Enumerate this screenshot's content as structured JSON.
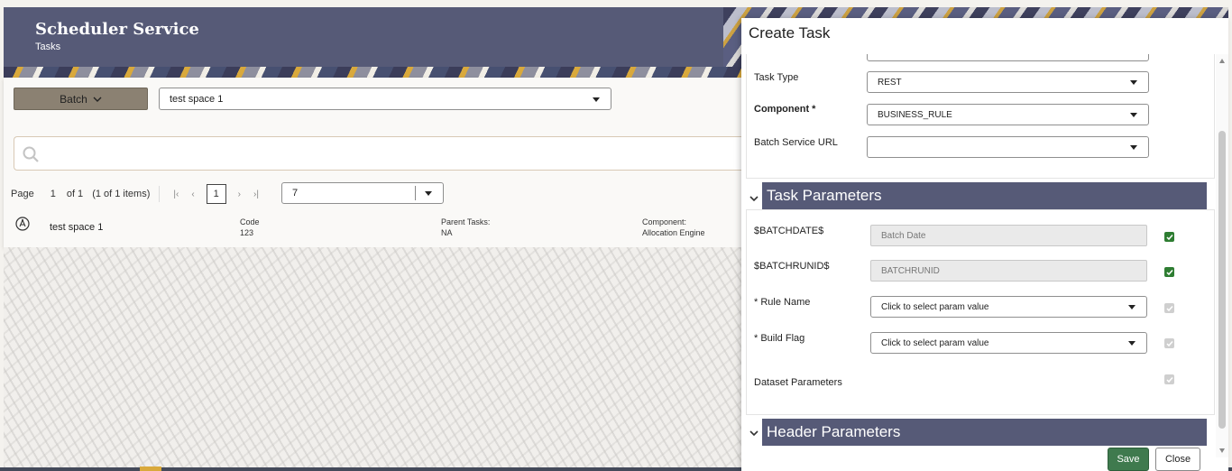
{
  "header": {
    "title": "Scheduler Service",
    "subtitle": "Tasks"
  },
  "toolbar": {
    "batch_label": "Batch",
    "space_value": "test space 1"
  },
  "pagination": {
    "page_label": "Page",
    "current_page": "1",
    "of_label": "of 1",
    "items_label": "(1 of 1 items)",
    "page_number": "1",
    "page_size": "7"
  },
  "task_row": {
    "name": "test space 1",
    "code_label": "Code",
    "code_value": "123",
    "parent_label": "Parent Tasks:",
    "parent_value": "NA",
    "component_label": "Component:",
    "component_value": "Allocation Engine"
  },
  "panel": {
    "title": "Create Task",
    "task_type_label": "Task Type",
    "task_type_value": "REST",
    "component_label": "Component *",
    "component_value": "BUSINESS_RULE",
    "batch_url_label": "Batch Service URL",
    "batch_url_value": "",
    "task_params_title": "Task Parameters",
    "params": [
      {
        "label": "$BATCHDATE$",
        "value": "Batch Date",
        "type": "input",
        "checked": true
      },
      {
        "label": "$BATCHRUNID$",
        "value": "BATCHRUNID",
        "type": "input",
        "checked": true
      },
      {
        "label": "* Rule Name",
        "value": "Click to select param value",
        "type": "select",
        "checked": false
      },
      {
        "label": "* Build Flag",
        "value": "Click to select param value",
        "type": "select",
        "checked": false
      },
      {
        "label": "Dataset Parameters",
        "value": "",
        "type": "none",
        "checked": false
      }
    ],
    "header_params_title": "Header Parameters",
    "save_label": "Save",
    "close_label": "Close"
  }
}
